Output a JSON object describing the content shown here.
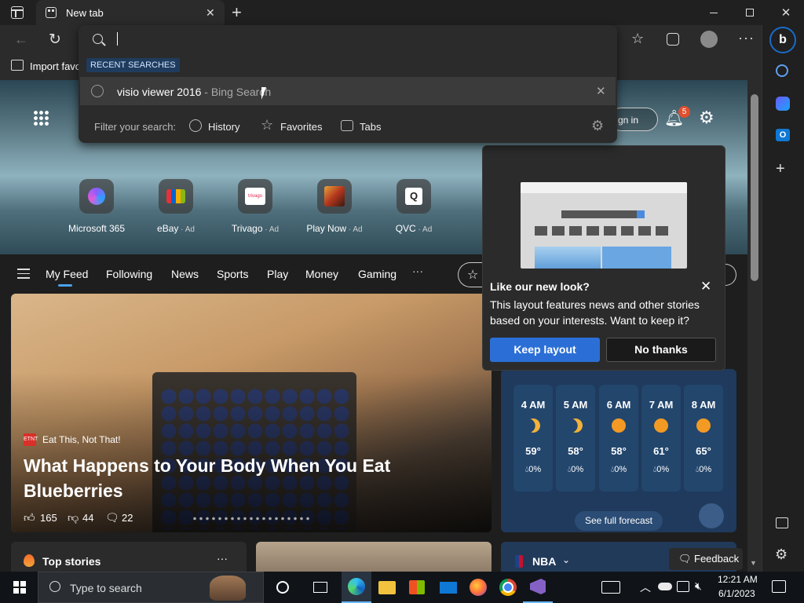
{
  "browser": {
    "tab_title": "New tab",
    "favorites_bar": {
      "import_label": "Import favo"
    },
    "omnibox": {
      "recent_searches_label": "RECENT SEARCHES",
      "suggestion": {
        "query": "visio viewer 2016",
        "source": " - Bing Search"
      },
      "filter_label": "Filter your search:",
      "filters": [
        "History",
        "Favorites",
        "Tabs"
      ]
    },
    "profile_notification_count": "5",
    "sign_in_label": "gn in"
  },
  "quick_links": [
    {
      "label": "Microsoft 365",
      "ad": ""
    },
    {
      "label": "eBay",
      "ad": " · Ad"
    },
    {
      "label": "Trivago",
      "ad": " · Ad"
    },
    {
      "label": "Play Now",
      "ad": " · Ad"
    },
    {
      "label": "QVC",
      "ad": " · Ad"
    }
  ],
  "feed_nav": [
    "My Feed",
    "Following",
    "News",
    "Sports",
    "Play",
    "Money",
    "Gaming"
  ],
  "main_article": {
    "source": "Eat This, Not That!",
    "title_line1": "What Happens to Your Body When You Eat",
    "title_line2": "Blueberries",
    "likes": "165",
    "dislikes": "44",
    "comments": "22"
  },
  "popup": {
    "title": "Like our new look?",
    "body_line1": "This layout features news and other stories",
    "body_line2": "based on your interests. Want to keep it?",
    "keep_label": "Keep layout",
    "no_label": "No thanks"
  },
  "weather": {
    "hours": [
      {
        "time": "4 AM",
        "temp": "59°",
        "precip": "0%",
        "icon": "moon"
      },
      {
        "time": "5 AM",
        "temp": "58°",
        "precip": "0%",
        "icon": "moon"
      },
      {
        "time": "6 AM",
        "temp": "58°",
        "precip": "0%",
        "icon": "sun"
      },
      {
        "time": "7 AM",
        "temp": "61°",
        "precip": "0%",
        "icon": "sun"
      },
      {
        "time": "8 AM",
        "temp": "65°",
        "precip": "0%",
        "icon": "sun"
      }
    ],
    "forecast_label": "See full forecast"
  },
  "bottom": {
    "top_stories": "Top stories",
    "nba": "NBA",
    "feedback": "Feedback"
  },
  "taskbar": {
    "search_placeholder": "Type to search",
    "time": "12:21 AM",
    "date": "6/1/2023"
  },
  "colors": {
    "accent": "#0f6cbd",
    "keep_button": "#2b6fd6",
    "bing": "#1b6ac9"
  }
}
